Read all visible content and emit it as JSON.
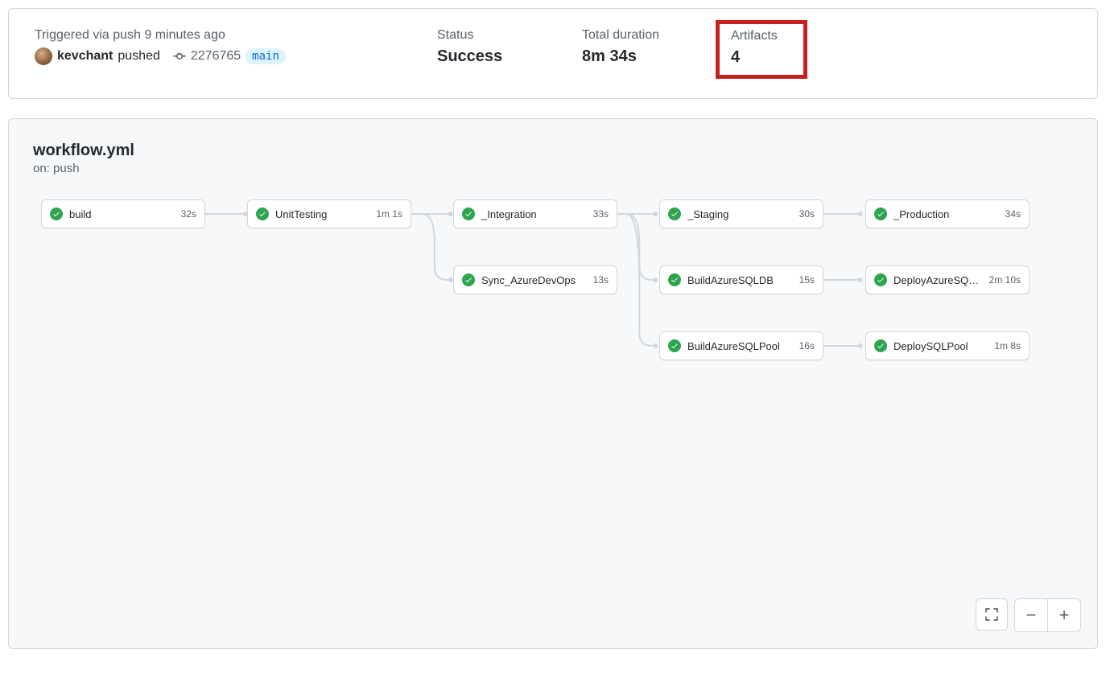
{
  "summary": {
    "triggered_label": "Triggered via push 9 minutes ago",
    "username": "kevchant",
    "pushed_text": "pushed",
    "commit_sha": "2276765",
    "branch": "main",
    "status_label": "Status",
    "status_value": "Success",
    "duration_label": "Total duration",
    "duration_value": "8m 34s",
    "artifacts_label": "Artifacts",
    "artifacts_value": "4"
  },
  "workflow": {
    "title": "workflow.yml",
    "subtitle": "on: push"
  },
  "jobs": {
    "build": {
      "name": "build",
      "duration": "32s"
    },
    "unit_testing": {
      "name": "UnitTesting",
      "duration": "1m 1s"
    },
    "integration": {
      "name": "_Integration",
      "duration": "33s"
    },
    "sync_azdo": {
      "name": "Sync_AzureDevOps",
      "duration": "13s"
    },
    "staging": {
      "name": "_Staging",
      "duration": "30s"
    },
    "build_sqldb": {
      "name": "BuildAzureSQLDB",
      "duration": "15s"
    },
    "build_sqlpool": {
      "name": "BuildAzureSQLPool",
      "duration": "16s"
    },
    "production": {
      "name": "_Production",
      "duration": "34s"
    },
    "deploy_sqldb": {
      "name": "DeployAzureSQLDB",
      "duration": "2m 10s"
    },
    "deploy_sqlpool": {
      "name": "DeploySQLPool",
      "duration": "1m 8s"
    }
  },
  "zoom": {
    "minus": "−",
    "plus": "+"
  }
}
